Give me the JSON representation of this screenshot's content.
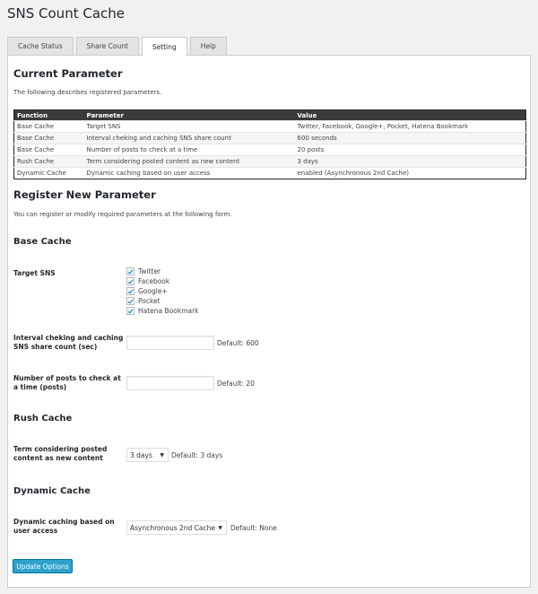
{
  "page": {
    "title": "SNS Count Cache"
  },
  "tabs": [
    {
      "label": "Cache Status",
      "active": false
    },
    {
      "label": "Share Count",
      "active": false
    },
    {
      "label": "Setting",
      "active": true
    },
    {
      "label": "Help",
      "active": false
    }
  ],
  "current": {
    "heading": "Current Parameter",
    "description": "The following describes registered parameters.",
    "columns": [
      "Function",
      "Parameter",
      "Value"
    ],
    "rows": [
      [
        "Base Cache",
        "Target SNS",
        "Twitter, Facebook, Google+, Pocket, Hatena Bookmark"
      ],
      [
        "Base Cache",
        "Interval cheking and caching SNS share count",
        "600 seconds"
      ],
      [
        "Base Cache",
        "Number of posts to check at a time",
        "20 posts"
      ],
      [
        "Rush Cache",
        "Term considering posted content as new content",
        "3 days"
      ],
      [
        "Dynamic Cache",
        "Dynamic caching based on user access",
        "enabled (Asynchronous 2nd Cache)"
      ]
    ]
  },
  "register": {
    "heading": "Register New Parameter",
    "description": "You can register or modify required parameters at the following form."
  },
  "base_cache": {
    "heading": "Base Cache",
    "target_label": "Target SNS",
    "sns": [
      {
        "label": "Twitter",
        "checked": true
      },
      {
        "label": "Facebook",
        "checked": true
      },
      {
        "label": "Google+",
        "checked": true
      },
      {
        "label": "Pocket",
        "checked": true
      },
      {
        "label": "Hatena Bookmark",
        "checked": true
      }
    ],
    "interval_label_1": "Interval cheking and caching",
    "interval_label_2": "SNS share count (sec)",
    "interval_value": "",
    "interval_default": "Default: 600",
    "posts_label_1": "Number of posts to check at",
    "posts_label_2": "a time (posts)",
    "posts_value": "",
    "posts_default": "Default: 20"
  },
  "rush_cache": {
    "heading": "Rush Cache",
    "term_label_1": "Term considering posted",
    "term_label_2": "content as new content",
    "term_value": "3 days",
    "term_default": "Default: 3 days"
  },
  "dynamic_cache": {
    "heading": "Dynamic Cache",
    "label_1": "Dynamic caching based on",
    "label_2": "user access",
    "value": "Asynchronous 2nd Cache",
    "default": "Default: None"
  },
  "submit_label": "Update Options",
  "colors": {
    "primary": "#2ea2cc",
    "header_bg": "#3a3a3a",
    "page_bg": "#f1f1f1"
  }
}
